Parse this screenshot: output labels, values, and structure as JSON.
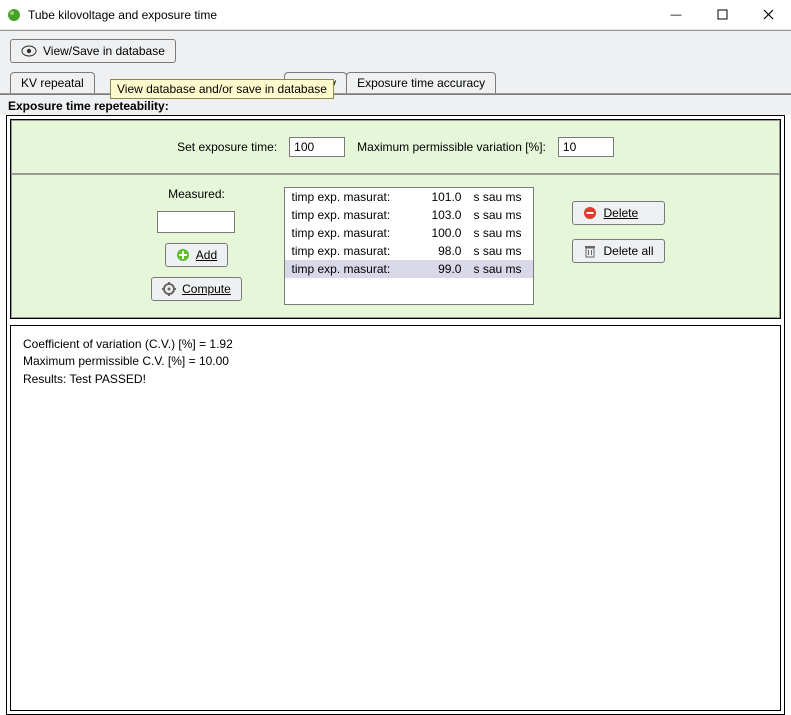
{
  "window": {
    "title": "Tube kilovoltage and exposure time"
  },
  "toolbar": {
    "view_save_label": "View/Save in database",
    "tooltip": "View database and/or save in database"
  },
  "tabs": {
    "kv_repeat": "KV repeatal",
    "accuracy_partial": "ccuracy",
    "exptime_accuracy": "Exposure time accuracy"
  },
  "section": {
    "title": "Exposure time repeteability:"
  },
  "set_row": {
    "set_label": "Set exposure time:",
    "set_value": "100",
    "max_label": "Maximum permissible variation [%]:",
    "max_value": "10"
  },
  "measured": {
    "label": "Measured:"
  },
  "buttons": {
    "add": "Add",
    "compute": "Compute",
    "delete": "Delete",
    "delete_all": "Delete all"
  },
  "list": {
    "rows": [
      {
        "label": "timp exp. masurat:",
        "value": "101.0",
        "unit": "s sau ms",
        "selected": false
      },
      {
        "label": "timp exp. masurat:",
        "value": "103.0",
        "unit": "s sau ms",
        "selected": false
      },
      {
        "label": "timp exp. masurat:",
        "value": "100.0",
        "unit": "s sau ms",
        "selected": false
      },
      {
        "label": "timp exp. masurat:",
        "value": "98.0",
        "unit": "s sau ms",
        "selected": false
      },
      {
        "label": "timp exp. masurat:",
        "value": "99.0",
        "unit": "s sau ms",
        "selected": true
      }
    ]
  },
  "results": {
    "line1": "Coefficient of variation (C.V.) [%] = 1.92",
    "line2": "Maximum permissible C.V. [%] = 10.00",
    "line3": "Results:  Test PASSED!"
  }
}
